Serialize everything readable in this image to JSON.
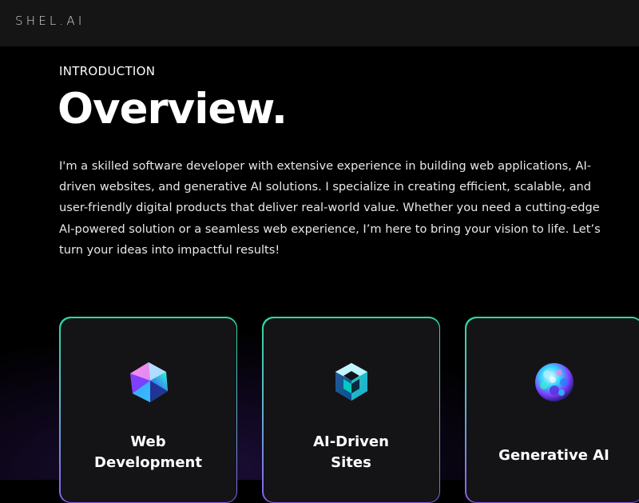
{
  "navbar": {
    "logo": "SHEL.AI"
  },
  "intro": {
    "label": "INTRODUCTION",
    "title": "Overview.",
    "text": "I'm a skilled software developer with extensive experience in building web applications, AI-driven websites, and generative AI solutions. I specialize in creating efficient, scalable, and user-friendly digital products that deliver real-world value. Whether you need a cutting-edge AI-powered solution or a seamless web experience, I’m here to bring your vision to life. Let’s turn your ideas into impactful results!"
  },
  "services": [
    {
      "title_line1": "Web",
      "title_line2": "Development",
      "icon": "crystal-icosahedron-icon"
    },
    {
      "title_line1": "AI-Driven",
      "title_line2": "Sites",
      "icon": "crystal-cube-icon"
    },
    {
      "title_line1": "Generative AI",
      "title_line2": "",
      "icon": "crystal-sphere-icon"
    }
  ],
  "colors": {
    "background": "#000000",
    "navbar": "#151515",
    "card": "#141416",
    "card_border_top": "#2fd8a0",
    "card_border_bottom": "#8a5cf0"
  }
}
